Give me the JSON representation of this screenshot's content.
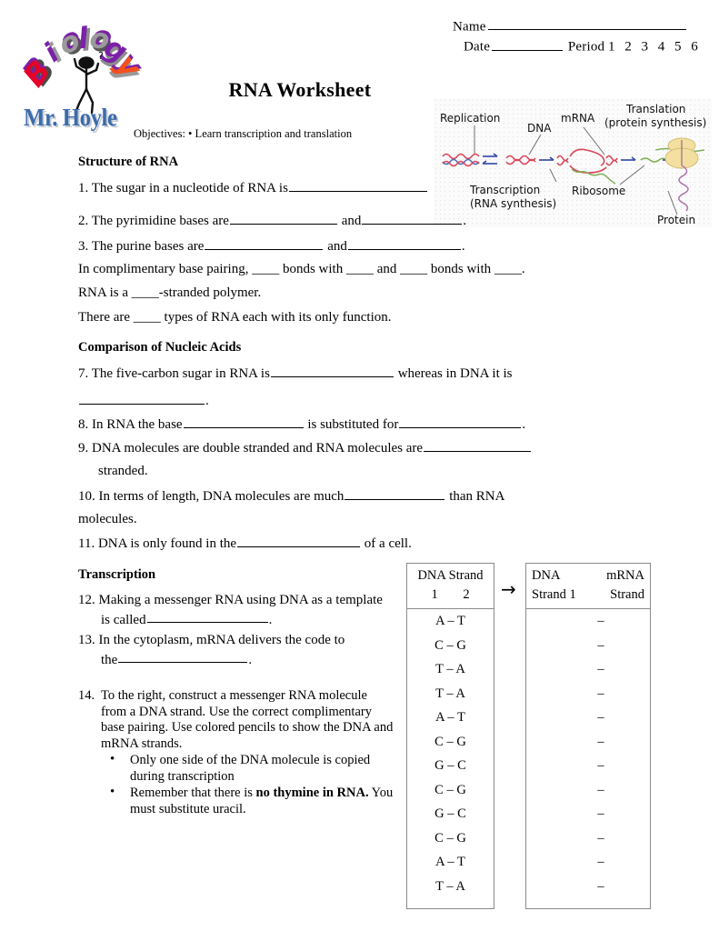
{
  "header": {
    "name_label": "Name",
    "date_label": "Date",
    "period_label": "Period",
    "periods": "1  2  3  4  5  6"
  },
  "logo": {
    "word": "Biology",
    "letters": [
      "B",
      "i",
      "o",
      "l",
      "o",
      "g",
      "y"
    ],
    "teacher": "Mr. Hoyle",
    "colors": {
      "red": "#e4022a",
      "purple": "#7b21a8",
      "magenta": "#c2007a",
      "gray": "#9a9a9a",
      "orange": "#f4511e",
      "name_blue": "#3c6cab"
    }
  },
  "title": "RNA Worksheet",
  "objectives": "Objectives:  • Learn transcription and translation",
  "diagram": {
    "labels": {
      "replication": "Replication",
      "dna": "DNA",
      "mrna": "mRNA",
      "translation_l1": "Translation",
      "translation_l2": "(protein synthesis)",
      "transcription_l1": "Transcription",
      "transcription_l2": "(RNA synthesis)",
      "ribosome": "Ribosome",
      "protein": "Protein"
    },
    "colors": {
      "dna_red": "#d9455b",
      "dna_blue": "#4a6fb5",
      "rna_green": "#7fae55",
      "arrow_blue": "#2f46a8",
      "ribosome": "#f3dfa0",
      "protein": "#b07ab0"
    }
  },
  "sections": {
    "structure": {
      "heading": "Structure of RNA",
      "questions": [
        {
          "num": "1.",
          "pre": "The sugar in a nucleotide of RNA is",
          "blanks": [
            150
          ],
          "post": ""
        },
        {
          "num": "2.",
          "pre": "The pyrimidine bases are",
          "mid": "and",
          "post": "."
        },
        {
          "num": "3.",
          "pre": "The purine bases are",
          "mid": "and",
          "post": "."
        },
        {
          "num": "4.",
          "text": "In complimentary base pairing, ____ bonds with ____ and ____ bonds with ____."
        },
        {
          "num": "5.",
          "text": "RNA is a ____-stranded polymer."
        },
        {
          "num": "6.",
          "text": "There are ____ types of RNA each with its only function."
        }
      ]
    },
    "comparison": {
      "heading": "Comparison of Nucleic Acids",
      "q7_a": "The five-carbon sugar in RNA is",
      "q7_b": "whereas in DNA it is",
      "q7_c": ".",
      "q8_a": "In RNA the base",
      "q8_b": "is substituted for",
      "q8_c": ".",
      "q9_a": "DNA molecules are double stranded and RNA molecules are",
      "q9_b": "stranded.",
      "q10_a": "In terms of length, DNA molecules are much",
      "q10_b": "than RNA",
      "q10_c": "molecules.",
      "q11_a": "DNA is only found in the",
      "q11_b": "of a cell."
    },
    "transcription": {
      "heading": "Transcription",
      "q12_l1": "Making a messenger RNA using DNA as a template",
      "q12_l2": "is called",
      "q12_end": ".",
      "q13_l1": "In the cytoplasm, mRNA delivers the code to",
      "q13_l2": "the",
      "q13_end": ".",
      "q14_num": "14.",
      "q14_body": "To the right, construct a messenger RNA molecule from a DNA strand. Use the correct complimentary base pairing.  Use colored pencils to show the DNA and mRNA strands.",
      "q14_bullets": [
        {
          "text": "Only one side of the DNA molecule is copied during transcription",
          "bold": ""
        },
        {
          "text_pre": "Remember that there is ",
          "bold": "no thymine in RNA.",
          "text_post": " You must substitute uracil."
        }
      ]
    }
  },
  "tables": {
    "arrow": "→",
    "dna_table": {
      "header_line1": "DNA Strand",
      "header_line2": "1    2",
      "rows": [
        "A – T",
        "C – G",
        "T – A",
        "T – A",
        "A – T",
        "C – G",
        "G – C",
        "C – G",
        "G – C",
        "C – G",
        "A – T",
        "T – A"
      ]
    },
    "mrna_table": {
      "header_col1_l1": "DNA",
      "header_col2_l1": "mRNA",
      "header_col1_l2": "Strand 1",
      "header_col2_l2": "Strand",
      "rows": [
        "–",
        "–",
        "–",
        "–",
        "–",
        "–",
        "–",
        "–",
        "–",
        "–",
        "–",
        "–"
      ]
    }
  }
}
